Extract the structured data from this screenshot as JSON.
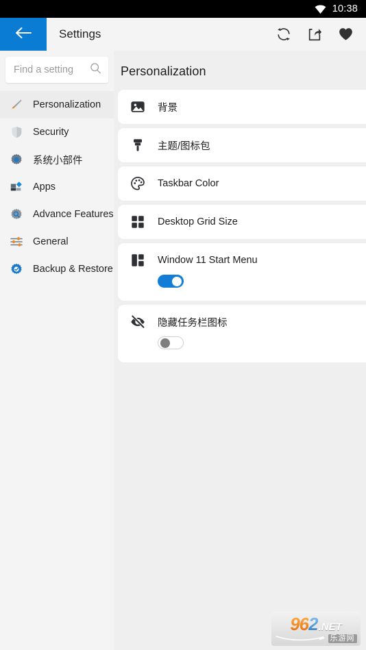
{
  "statusbar": {
    "time": "10:38",
    "wifi_icon": "wifi-icon"
  },
  "appbar": {
    "back_icon": "back-arrow-icon",
    "title": "Settings",
    "actions": [
      {
        "name": "refresh-icon",
        "label": "Refresh"
      },
      {
        "name": "share-icon",
        "label": "Share"
      },
      {
        "name": "heart-icon",
        "label": "Favorite"
      }
    ]
  },
  "search": {
    "placeholder": "Find a setting",
    "value": "",
    "icon": "search-icon"
  },
  "sidebar": {
    "items": [
      {
        "label": "Personalization",
        "icon": "paintbrush-icon",
        "active": true
      },
      {
        "label": "Security",
        "icon": "shield-icon",
        "active": false
      },
      {
        "label": "系统小部件",
        "icon": "gear-blue-icon",
        "active": false
      },
      {
        "label": "Apps",
        "icon": "apps-blocks-icon",
        "active": false
      },
      {
        "label": "Advance Features",
        "icon": "gear-search-icon",
        "active": false
      },
      {
        "label": "General",
        "icon": "sliders-icon",
        "active": false
      },
      {
        "label": "Backup & Restore",
        "icon": "gear-check-icon",
        "active": false
      }
    ]
  },
  "main": {
    "page_title": "Personalization",
    "cards": [
      {
        "label": "背景",
        "icon": "image-icon",
        "toggle": null
      },
      {
        "label": "主题/图标包",
        "icon": "paintbrush-filled-icon",
        "toggle": null
      },
      {
        "label": "Taskbar Color",
        "icon": "palette-icon",
        "toggle": null
      },
      {
        "label": "Desktop Grid Size",
        "icon": "grid-four-icon",
        "toggle": null
      },
      {
        "label": "Window 11 Start Menu",
        "icon": "windows11-layout-icon",
        "toggle": "on"
      },
      {
        "label": "隐藏任务栏图标",
        "icon": "eye-off-icon",
        "toggle": "off"
      }
    ]
  },
  "watermark": {
    "num_96": "96",
    "num_2": "2",
    "net": ".NET",
    "cn": "乐游网"
  },
  "colors": {
    "accent_blue": "#0a7cd4",
    "toggle_on": "#127cd6",
    "statusbar": "#000000",
    "appbar": "#f4f4f4",
    "sidebar": "#f4f4f4",
    "page_bg": "#efefef",
    "card_bg": "#ffffff"
  }
}
